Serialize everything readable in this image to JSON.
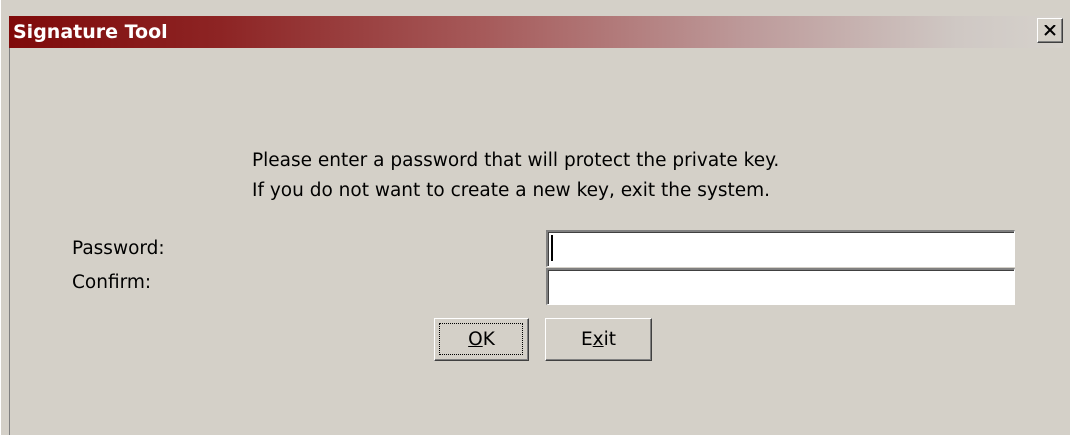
{
  "window": {
    "title": "Signature Tool",
    "close_icon": "close-x-icon",
    "titlebar_color_start": "#7f0a0a",
    "titlebar_color_end": "#d6d2cc",
    "face_color": "#d4d0c8"
  },
  "message": {
    "line1": "Please enter a password that will protect the private key.",
    "line2": "If you do not want to create a new key, exit the system."
  },
  "form": {
    "password_label": "Password:",
    "password_value": "",
    "confirm_label": "Confirm:",
    "confirm_value": ""
  },
  "buttons": {
    "ok_label_mnemonic": "O",
    "ok_label_rest": "K",
    "exit_label_pre": "E",
    "exit_label_mnemonic": "x",
    "exit_label_post": "it"
  }
}
